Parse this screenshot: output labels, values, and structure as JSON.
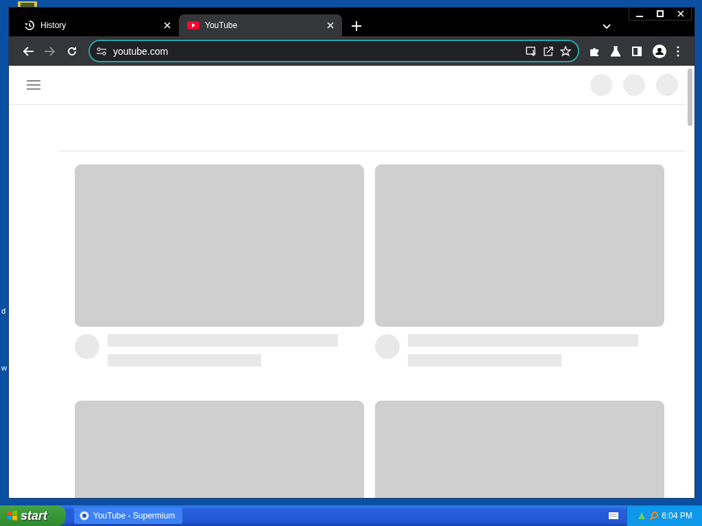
{
  "desktop": {
    "icon_labels": [
      "d",
      "w"
    ]
  },
  "browser": {
    "tabs": [
      {
        "title": "History",
        "kind": "history",
        "selected": false
      },
      {
        "title": "YouTube",
        "kind": "youtube",
        "selected": true
      }
    ],
    "address": {
      "value": "youtube.com"
    },
    "video_cards": [
      {
        "kind": "skeleton"
      },
      {
        "kind": "skeleton"
      },
      {
        "kind": "thumbnail-only"
      },
      {
        "kind": "thumbnail-only"
      }
    ]
  },
  "taskbar": {
    "start": "start",
    "tasks": [
      {
        "title": "YouTube - Supermium",
        "selected": false
      }
    ],
    "clock": "6:04 PM"
  }
}
